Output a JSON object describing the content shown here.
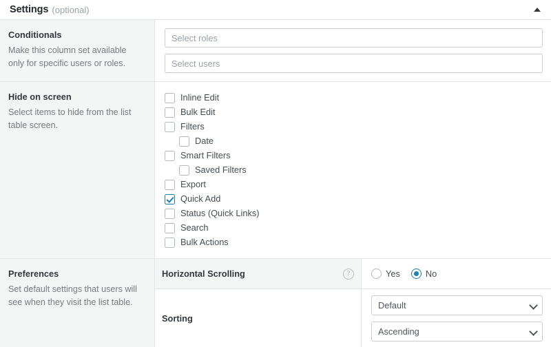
{
  "header": {
    "title": "Settings",
    "optional": "(optional)",
    "collapse_icon": "triangle-up-icon"
  },
  "sections": {
    "conditionals": {
      "title": "Conditionals",
      "description": "Make this column set available only for specific users or roles.",
      "roles_placeholder": "Select roles",
      "roles_value": "",
      "users_placeholder": "Select users",
      "users_value": ""
    },
    "hide_on_screen": {
      "title": "Hide on screen",
      "description": "Select items to hide from the list table screen.",
      "items": [
        {
          "label": "Inline Edit",
          "checked": false,
          "indent": false
        },
        {
          "label": "Bulk Edit",
          "checked": false,
          "indent": false
        },
        {
          "label": "Filters",
          "checked": false,
          "indent": false
        },
        {
          "label": "Date",
          "checked": false,
          "indent": true
        },
        {
          "label": "Smart Filters",
          "checked": false,
          "indent": false
        },
        {
          "label": "Saved Filters",
          "checked": false,
          "indent": true
        },
        {
          "label": "Export",
          "checked": false,
          "indent": false
        },
        {
          "label": "Quick Add",
          "checked": true,
          "indent": false
        },
        {
          "label": "Status (Quick Links)",
          "checked": false,
          "indent": false
        },
        {
          "label": "Search",
          "checked": false,
          "indent": false
        },
        {
          "label": "Bulk Actions",
          "checked": false,
          "indent": false
        }
      ]
    },
    "preferences": {
      "title": "Preferences",
      "description": "Set default settings that users will see when they visit the list table.",
      "horizontal_scrolling": {
        "label": "Horizontal Scrolling",
        "help_icon": "question-mark-icon",
        "options": [
          {
            "label": "Yes",
            "selected": false
          },
          {
            "label": "No",
            "selected": true
          }
        ]
      },
      "sorting": {
        "label": "Sorting",
        "column_value": "Default",
        "order_value": "Ascending"
      }
    }
  },
  "colors": {
    "accent": "#1a7fb5",
    "label_bg": "#f4f5f5",
    "border": "#e2e4e7",
    "text": "#32373c",
    "muted_text": "#767b7f"
  }
}
